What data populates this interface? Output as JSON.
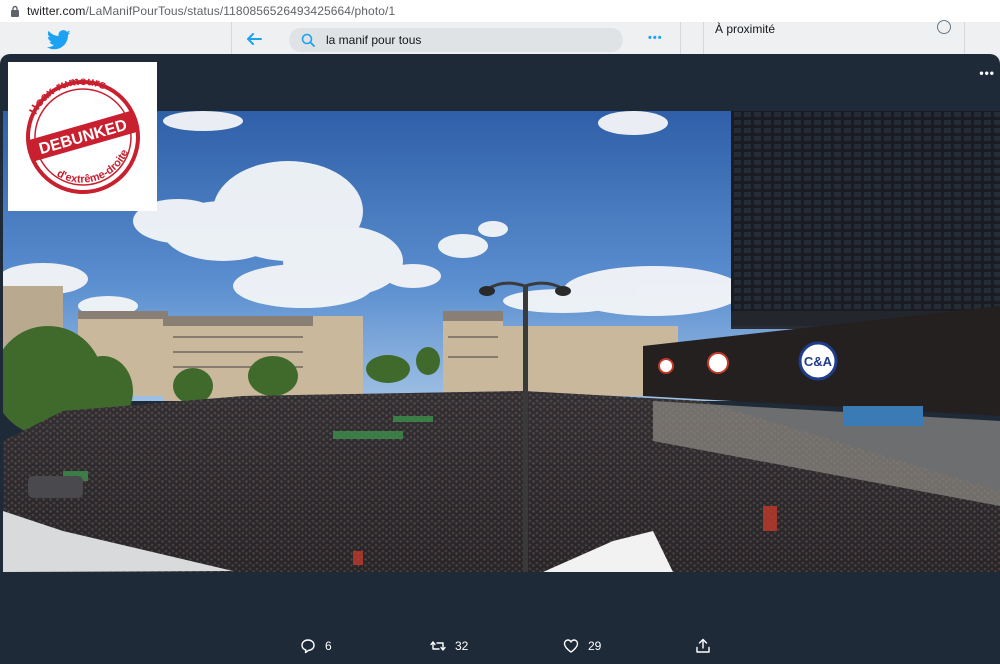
{
  "browser": {
    "url_host": "twitter.com",
    "url_path": "/LaManifPourTous/status/1180856526493425664/photo/1"
  },
  "twitter": {
    "search_value": "la manif pour tous",
    "more_label": "•••",
    "nearby_label": "À proximité"
  },
  "overlay": {
    "more_label": "•••",
    "stamp": {
      "top_text": "Hoax-rumeurs",
      "center_text": "DEBUNKED",
      "bottom_text": "d'extrême-droite"
    },
    "photo": {
      "store_sign": "C&A"
    }
  },
  "actions": {
    "reply_count": "6",
    "retweet_count": "32",
    "like_count": "29"
  },
  "colors": {
    "twitter_blue": "#1da1f2",
    "overlay_bg": "#1f2a39",
    "stamp_red": "#c8202f"
  }
}
